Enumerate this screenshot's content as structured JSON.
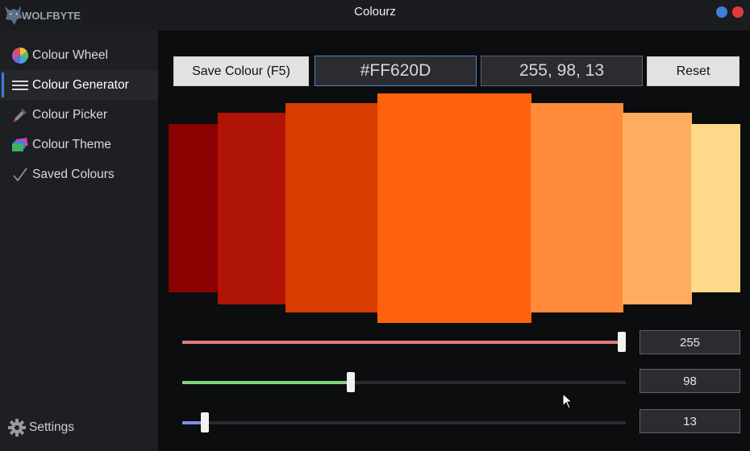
{
  "window": {
    "title": "Colourz",
    "logo_text": "WOLFBYTE"
  },
  "sidebar": {
    "items": [
      {
        "label": "Colour Wheel",
        "icon": "colour-wheel-icon"
      },
      {
        "label": "Colour Generator",
        "icon": "generator-lines-icon",
        "active": true
      },
      {
        "label": "Colour Picker",
        "icon": "eyedropper-icon"
      },
      {
        "label": "Colour Theme",
        "icon": "theme-cards-icon"
      },
      {
        "label": "Saved Colours",
        "icon": "checkmark-icon"
      }
    ],
    "settings_label": "Settings"
  },
  "toolbar": {
    "save_label": "Save Colour (F5)",
    "hex_value": "#FF620D",
    "rgb_value": "255, 98, 13",
    "reset_label": "Reset"
  },
  "swatches": [
    "#8B0000",
    "#B01406",
    "#D83C00",
    "#FF620D",
    "#FF8A3A",
    "#FFAC5E",
    "#FFD98A"
  ],
  "sliders": [
    {
      "channel": "red",
      "value": "255",
      "fraction": 1.0,
      "color": "#e07d7d"
    },
    {
      "channel": "green",
      "value": "98",
      "fraction": 0.384,
      "color": "#7ed47e"
    },
    {
      "channel": "blue",
      "value": "13",
      "fraction": 0.051,
      "color": "#7f8fe3"
    }
  ]
}
